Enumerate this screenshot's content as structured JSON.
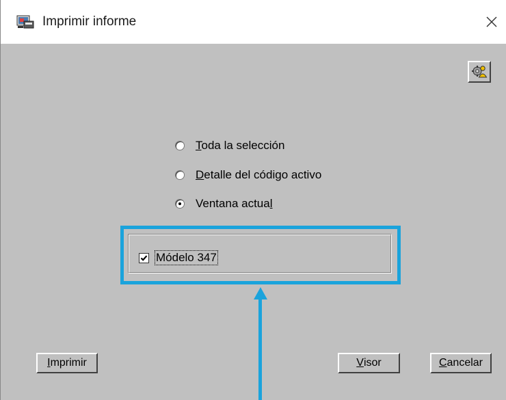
{
  "window": {
    "title": "Imprimir informe",
    "title_icon": "report-printer-icon",
    "close_icon": "close-icon",
    "settings_icon": "settings-user-icon"
  },
  "options": [
    {
      "mnemonic": "T",
      "rest": "oda la selección",
      "checked": false
    },
    {
      "mnemonic": "D",
      "rest": "etalle del código activo",
      "checked": false
    },
    {
      "prefix": "Ventana actua",
      "mnemonic": "l",
      "checked": true
    }
  ],
  "checkbox": {
    "label": "Módelo 347",
    "checked": true
  },
  "buttons": {
    "print": {
      "mnemonic": "I",
      "rest": "mprimir"
    },
    "viewer": {
      "mnemonic": "V",
      "rest": "isor"
    },
    "cancel": {
      "mnemonic": "C",
      "rest": "ancelar"
    }
  },
  "annotation": {
    "color": "#1aa3dc"
  }
}
